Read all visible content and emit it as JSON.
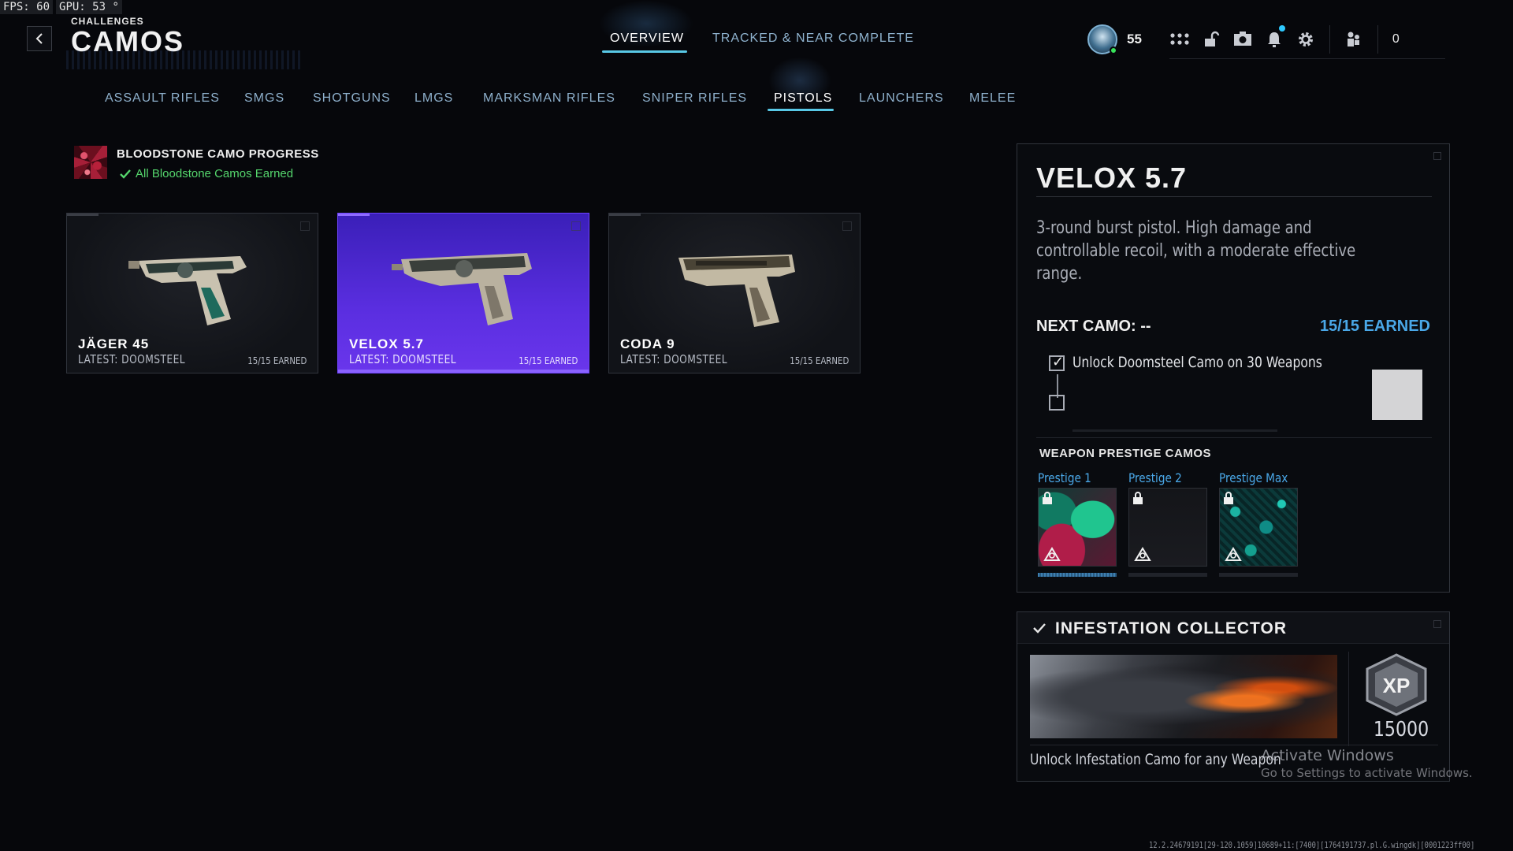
{
  "perf": {
    "fps": "FPS:  60",
    "gpu": "GPU: 53 °"
  },
  "header": {
    "breadcrumb": "CHALLENGES",
    "title": "CAMOS",
    "tabs": [
      {
        "label": "OVERVIEW",
        "active": true
      },
      {
        "label": "TRACKED & NEAR COMPLETE",
        "active": false
      }
    ],
    "rank": "55",
    "currency": "0"
  },
  "categories": [
    {
      "label": "ASSAULT RIFLES"
    },
    {
      "label": "SMGS"
    },
    {
      "label": "SHOTGUNS"
    },
    {
      "label": "LMGS"
    },
    {
      "label": "MARKSMAN RIFLES"
    },
    {
      "label": "SNIPER RIFLES"
    },
    {
      "label": "PISTOLS",
      "active": true
    },
    {
      "label": "LAUNCHERS"
    },
    {
      "label": "MELEE"
    }
  ],
  "progress": {
    "title": "BLOODSTONE CAMO PROGRESS",
    "status": "All Bloodstone Camos Earned"
  },
  "weapons": [
    {
      "name": "JÄGER 45",
      "latest": "LATEST: DOOMSTEEL",
      "earned": "15/15 EARNED",
      "selected": false
    },
    {
      "name": "VELOX 5.7",
      "latest": "LATEST: DOOMSTEEL",
      "earned": "15/15 EARNED",
      "selected": true
    },
    {
      "name": "CODA 9",
      "latest": "LATEST: DOOMSTEEL",
      "earned": "15/15 EARNED",
      "selected": false
    }
  ],
  "detail": {
    "name": "VELOX 5.7",
    "description": "3-round burst pistol. High damage and controllable recoil, with a moderate effective range.",
    "next_camo": "NEXT CAMO: --",
    "earned_total": "15/15 EARNED",
    "challenge": "Unlock Doomsteel Camo on 30 Weapons",
    "prestige_title": "WEAPON PRESTIGE CAMOS",
    "prestige": [
      {
        "label": "Prestige 1",
        "progress": 1.0
      },
      {
        "label": "Prestige 2",
        "progress": 0.0
      },
      {
        "label": "Prestige Max",
        "progress": 0.0
      }
    ]
  },
  "event": {
    "title": "INFESTATION COLLECTOR",
    "xp_label": "XP",
    "xp_amount": "15000",
    "description": "Unlock Infestation Camo for any Weapon"
  },
  "watermark": {
    "title": "Activate Windows",
    "subtitle": "Go to Settings to activate Windows."
  },
  "build_string": "12.2.24679191[29-120.1059]10689+11:[7400][1764191737.pl.G.wingdk][0001223ff00]",
  "colors": {
    "accent_blue": "#4aa8e8",
    "selected_purple": "#5a2ee0",
    "success_green": "#55d66d",
    "tab_underline": "#58c8e6"
  }
}
